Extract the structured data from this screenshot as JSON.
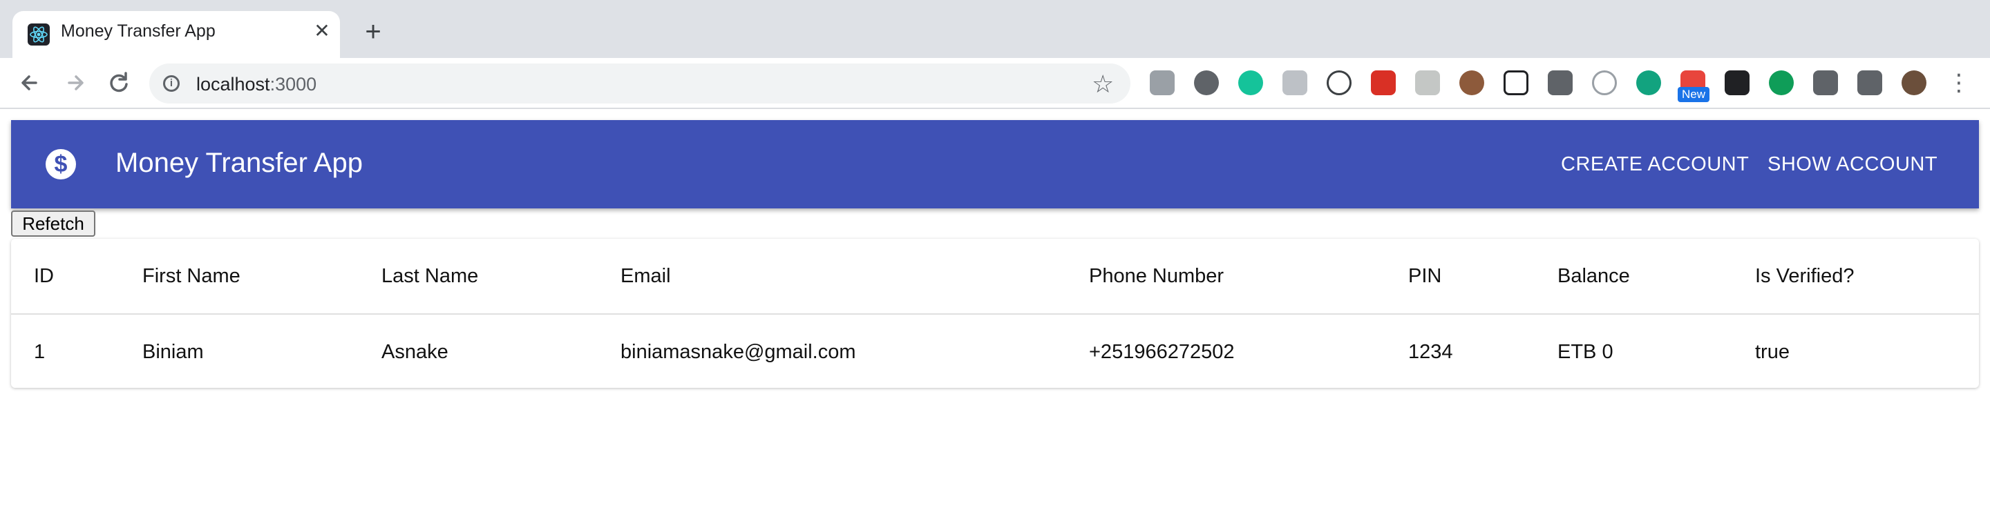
{
  "browser": {
    "tab_title": "Money Transfer App",
    "tab_close": "✕",
    "new_tab": "+",
    "url_host": "localhost",
    "url_port": ":3000",
    "extension_badge": "New",
    "icons": [
      "back-icon",
      "forward-icon",
      "reload-icon",
      "info-icon",
      "star-icon",
      "menu-icon"
    ]
  },
  "appbar": {
    "logo_glyph": "$",
    "title": "Money Transfer App",
    "links": [
      "CREATE ACCOUNT",
      "SHOW ACCOUNT"
    ],
    "color": "#3f51b5"
  },
  "refetch_label": "Refetch",
  "table": {
    "headers": [
      "ID",
      "First Name",
      "Last Name",
      "Email",
      "Phone Number",
      "PIN",
      "Balance",
      "Is Verified?"
    ],
    "rows": [
      [
        "1",
        "Biniam",
        "Asnake",
        "biniamasnake@gmail.com",
        "+251966272502",
        "1234",
        "ETB 0",
        "true"
      ]
    ]
  }
}
